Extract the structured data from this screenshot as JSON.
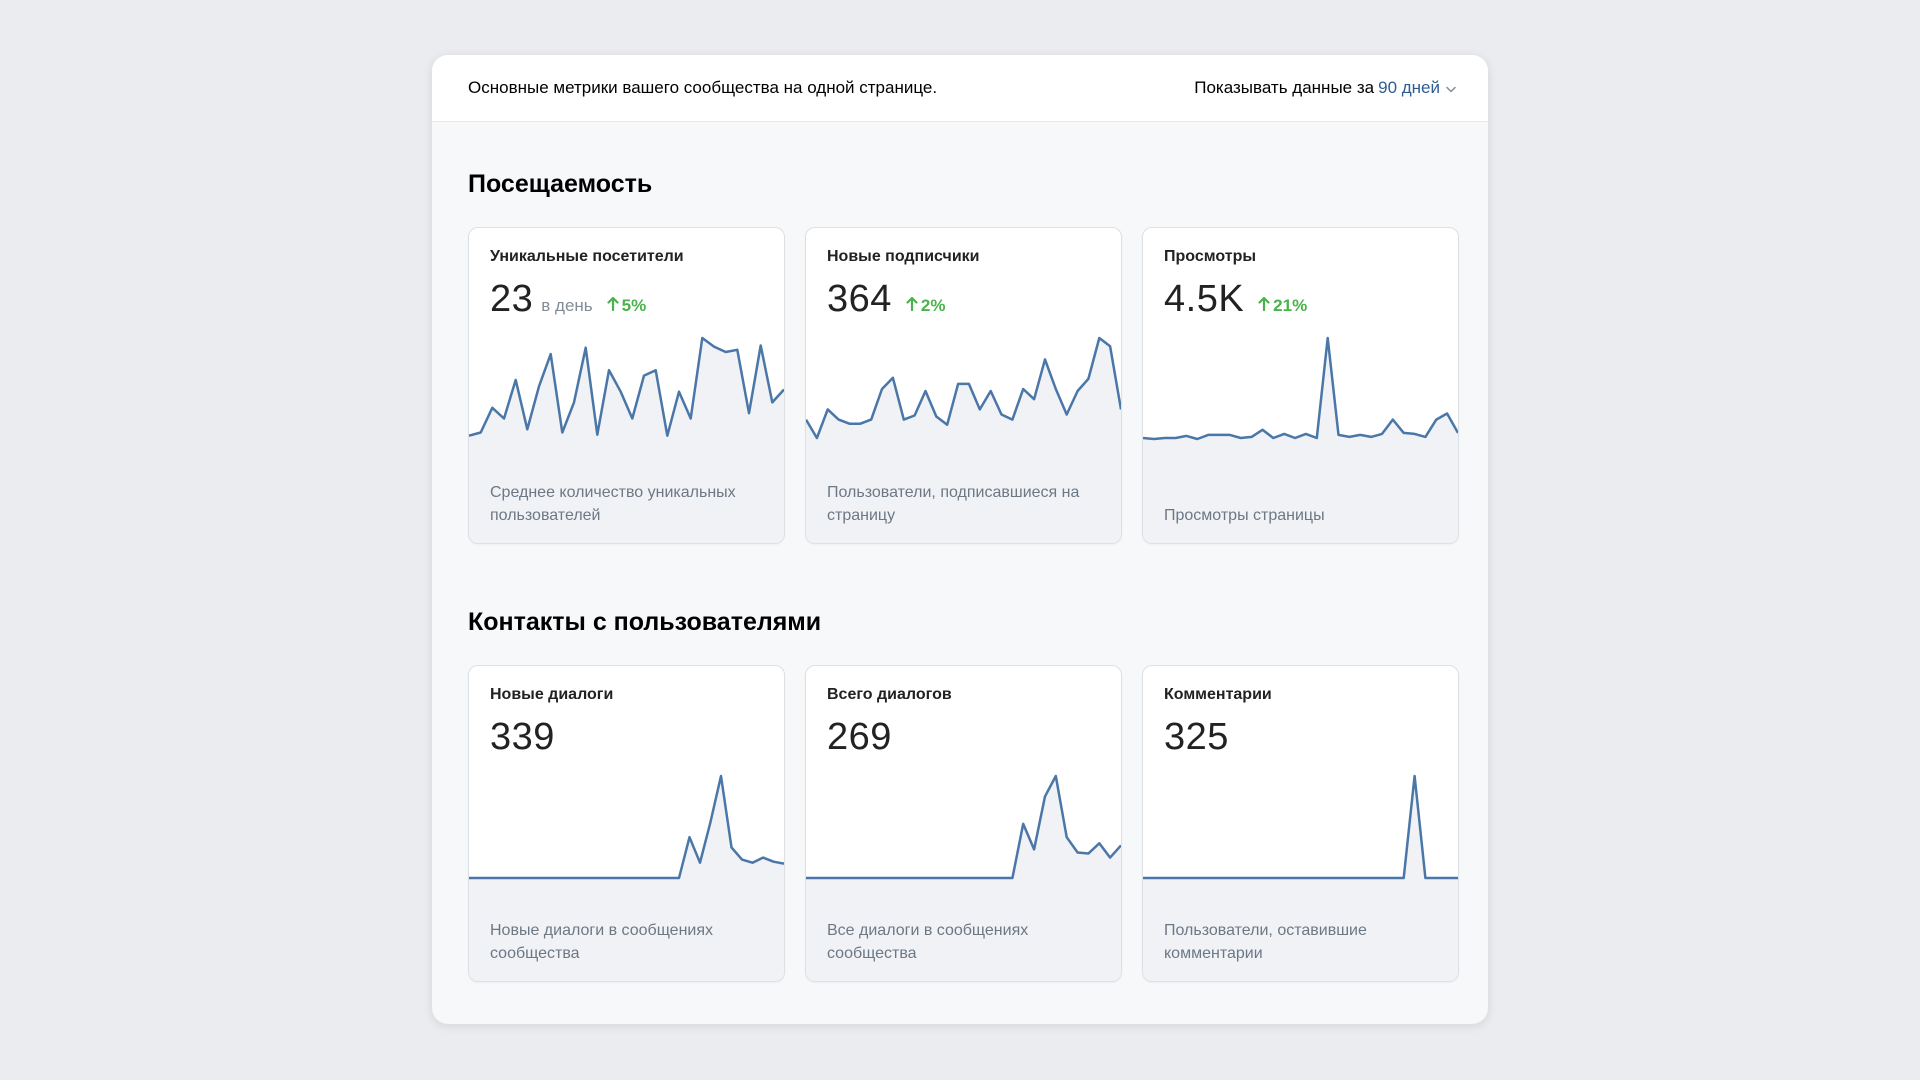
{
  "header": {
    "subtitle": "Основные метрики вашего сообщества на одной странице.",
    "period_label": "Показывать данные за",
    "period_value": "90 дней"
  },
  "sections": [
    {
      "title": "Посещаемость",
      "cards": [
        {
          "title": "Уникальные посетители",
          "value": "23",
          "unit": "в день",
          "change": "5%",
          "change_color": "#4bb34b",
          "description": "Среднее количество уникальных пользователей",
          "series": [
            4,
            7,
            30,
            20,
            56,
            10,
            50,
            80,
            7,
            35,
            86,
            5,
            65,
            45,
            20,
            60,
            65,
            4,
            45,
            20,
            95,
            87,
            82,
            84,
            25,
            88,
            35,
            47
          ]
        },
        {
          "title": "Новые подписчики",
          "value": "364",
          "change": "2%",
          "change_color": "#4bb34b",
          "description": "Пользователи, подписавшиеся на страницу",
          "series": [
            20,
            2,
            30,
            20,
            16,
            16,
            20,
            50,
            61,
            20,
            24,
            48,
            23,
            15,
            55,
            55,
            30,
            48,
            25,
            20,
            50,
            40,
            79,
            50,
            25,
            48,
            60,
            100,
            92,
            30
          ]
        },
        {
          "title": "Просмотры",
          "value": "4.5K",
          "change": "21%",
          "change_color": "#4bb34b",
          "description": "Просмотры страницы",
          "series": [
            2,
            1,
            2,
            2,
            4,
            1,
            5,
            5,
            5,
            2,
            3,
            10,
            2,
            6,
            2,
            6,
            2,
            100,
            5,
            3,
            5,
            3,
            6,
            20,
            7,
            6,
            3,
            20,
            26,
            7
          ]
        }
      ]
    },
    {
      "title": "Контакты с пользователями",
      "cards": [
        {
          "title": "Новые диалоги",
          "value": "339",
          "description": "Новые диалоги в сообщениях сообщества",
          "series": [
            0,
            0,
            0,
            0,
            0,
            0,
            0,
            0,
            0,
            0,
            0,
            0,
            0,
            0,
            0,
            0,
            0,
            0,
            0,
            0,
            0,
            40,
            15,
            55,
            100,
            30,
            18,
            15,
            20,
            16,
            14
          ]
        },
        {
          "title": "Всего диалогов",
          "value": "269",
          "description": "Все диалоги в сообщениях сообщества",
          "series": [
            0,
            0,
            0,
            0,
            0,
            0,
            0,
            0,
            0,
            0,
            0,
            0,
            0,
            0,
            0,
            0,
            0,
            0,
            0,
            0,
            53,
            28,
            80,
            100,
            40,
            25,
            24,
            34,
            20,
            32
          ]
        },
        {
          "title": "Комментарии",
          "value": "325",
          "description": "Пользователи, оставившие комментарии",
          "series": [
            0,
            0,
            0,
            0,
            0,
            0,
            0,
            0,
            0,
            0,
            0,
            0,
            0,
            0,
            0,
            0,
            0,
            0,
            0,
            0,
            0,
            0,
            0,
            0,
            0,
            100,
            0,
            0,
            0,
            0
          ]
        }
      ]
    }
  ],
  "colors": {
    "line": "#4a76a8",
    "fill": "#f0f2f5",
    "link": "#2d5d91"
  }
}
